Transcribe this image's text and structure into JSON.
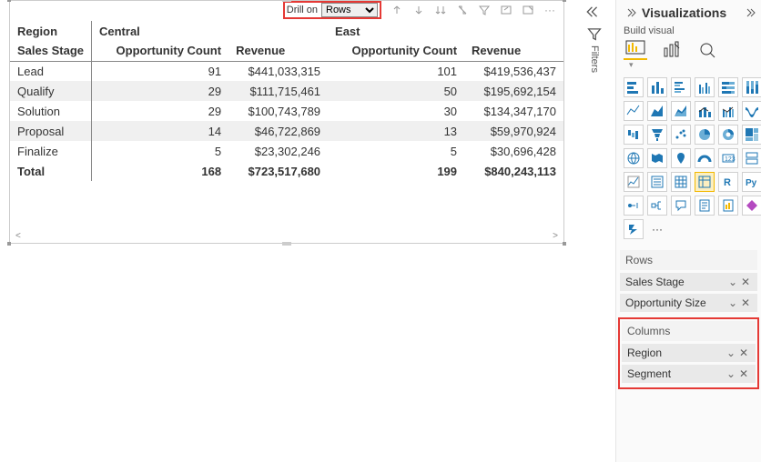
{
  "toolbar": {
    "drill_label": "Drill on",
    "drill_option": "Rows"
  },
  "matrix": {
    "row_header1": "Region",
    "row_header2": "Sales Stage",
    "col1": "Central",
    "col2": "East",
    "metric1": "Opportunity Count",
    "metric2": "Revenue",
    "rows": [
      {
        "stage": "Lead",
        "c1": "91",
        "r1": "$441,033,315",
        "c2": "101",
        "r2": "$419,536,437"
      },
      {
        "stage": "Qualify",
        "c1": "29",
        "r1": "$111,715,461",
        "c2": "50",
        "r2": "$195,692,154"
      },
      {
        "stage": "Solution",
        "c1": "29",
        "r1": "$100,743,789",
        "c2": "30",
        "r2": "$134,347,170"
      },
      {
        "stage": "Proposal",
        "c1": "14",
        "r1": "$46,722,869",
        "c2": "13",
        "r2": "$59,970,924"
      },
      {
        "stage": "Finalize",
        "c1": "5",
        "r1": "$23,302,246",
        "c2": "5",
        "r2": "$30,696,428"
      }
    ],
    "total": {
      "label": "Total",
      "c1": "168",
      "r1": "$723,517,680",
      "c2": "199",
      "r2": "$840,243,113"
    }
  },
  "filters": {
    "label": "Filters"
  },
  "pane": {
    "title": "Visualizations",
    "sub": "Build visual",
    "rows_label": "Rows",
    "rows_items": [
      "Sales Stage",
      "Opportunity Size"
    ],
    "cols_label": "Columns",
    "cols_items": [
      "Region",
      "Segment"
    ],
    "more": "···"
  },
  "viz_icons": [
    "stacked-bar",
    "stacked-column",
    "clustered-bar",
    "clustered-column",
    "hundred-bar",
    "hundred-column",
    "line",
    "area",
    "stacked-area",
    "line-stacked",
    "line-clustered",
    "ribbon",
    "waterfall",
    "funnel",
    "scatter",
    "pie",
    "donut",
    "treemap",
    "map",
    "filled-map",
    "azure-map",
    "gauge",
    "card",
    "multi-card",
    "kpi",
    "slicer",
    "table",
    "matrix",
    "r-visual",
    "python-visual",
    "key-influencers",
    "decomposition",
    "qna",
    "narrative",
    "paginated",
    "powerapps",
    "powerautomate",
    "empty",
    "more-visuals"
  ]
}
